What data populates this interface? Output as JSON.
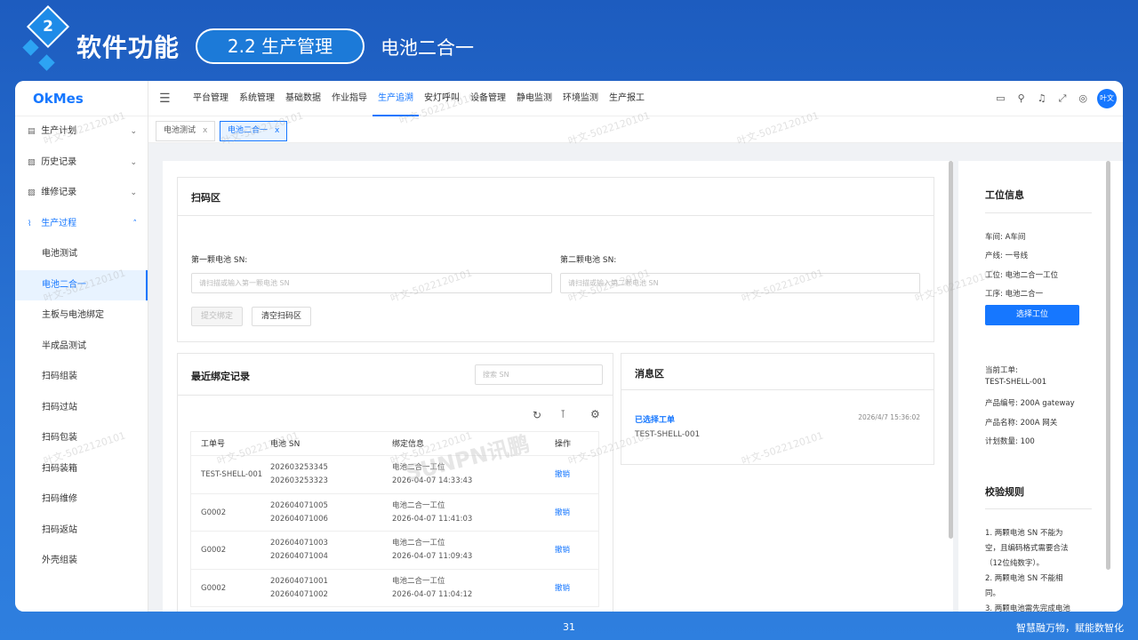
{
  "slide": {
    "number": "2",
    "title": "软件功能",
    "section": "2.2 生产管理",
    "subtitle": "电池二合一",
    "page": "31",
    "slogan": "智慧融万物，赋能数智化"
  },
  "app": {
    "logo": "OkMes",
    "watermark": "叶文-5022120101",
    "big_watermark": "SUNPN讯鹏",
    "user_avatar": "叶文"
  },
  "sidebar": {
    "groups": [
      {
        "label": "生产计划",
        "icon": "plan-icon",
        "expanded": false
      },
      {
        "label": "历史记录",
        "icon": "history-icon",
        "expanded": false
      },
      {
        "label": "维修记录",
        "icon": "repair-icon",
        "expanded": false
      },
      {
        "label": "生产过程",
        "icon": "process-icon",
        "expanded": true
      }
    ],
    "items": [
      "电池测试",
      "电池二合一",
      "主板与电池绑定",
      "半成品测试",
      "扫码组装",
      "扫码过站",
      "扫码包装",
      "扫码装箱",
      "扫码维修",
      "扫码返站",
      "外壳组装"
    ],
    "active_item": "电池二合一"
  },
  "topnav": {
    "items": [
      "平台管理",
      "系统管理",
      "基础数据",
      "作业指导",
      "生产追溯",
      "安灯呼叫",
      "设备管理",
      "静电监测",
      "环境监测",
      "生产报工"
    ],
    "active": "生产追溯",
    "icons": [
      "monitor-icon",
      "search-icon",
      "bell-icon",
      "fullscreen-icon",
      "globe-icon"
    ]
  },
  "tabs": [
    {
      "label": "电池测试",
      "active": false
    },
    {
      "label": "电池二合一",
      "active": true
    }
  ],
  "scan_area": {
    "title": "扫码区",
    "first_label": "第一颗电池 SN:",
    "first_placeholder": "请扫描或输入第一颗电池 SN",
    "second_label": "第二颗电池 SN:",
    "second_placeholder": "请扫描或输入第二颗电池 SN",
    "submit_label": "提交绑定",
    "clear_label": "清空扫码区"
  },
  "records": {
    "title": "最近绑定记录",
    "search_placeholder": "搜索 SN",
    "columns": [
      "工单号",
      "电池 SN",
      "绑定信息",
      "操作"
    ],
    "rows": [
      {
        "order": "TEST-SHELL-001",
        "sn1": "202603253345",
        "sn2": "202603253323",
        "station": "电池二合一工位",
        "time": "2026-04-07 14:33:43",
        "action": "撤销"
      },
      {
        "order": "G0002",
        "sn1": "202604071005",
        "sn2": "202604071006",
        "station": "电池二合一工位",
        "time": "2026-04-07 11:41:03",
        "action": "撤销"
      },
      {
        "order": "G0002",
        "sn1": "202604071003",
        "sn2": "202604071004",
        "station": "电池二合一工位",
        "time": "2026-04-07 11:09:43",
        "action": "撤销"
      },
      {
        "order": "G0002",
        "sn1": "202604071001",
        "sn2": "202604071002",
        "station": "电池二合一工位",
        "time": "2026-04-07 11:04:12",
        "action": "撤销"
      }
    ]
  },
  "messages": {
    "title": "消息区",
    "items": [
      {
        "heading": "已选择工单",
        "time": "2026/4/7 15:36:02",
        "body": "TEST-SHELL-001"
      }
    ]
  },
  "station_info": {
    "title": "工位信息",
    "workshop": "车间: A车间",
    "line": "产线: 一号线",
    "station": "工位: 电池二合一工位",
    "process": "工序: 电池二合一",
    "select_button": "选择工位",
    "order_label": "当前工单:",
    "order_value": "TEST-SHELL-001",
    "product_code": "产品编号: 200A gateway",
    "product_name": "产品名称: 200A 网关",
    "plan_qty": "计划数量: 100"
  },
  "rules": {
    "title": "校验规则",
    "lines": [
      "1. 两颗电池 SN 不能为",
      "空，且编码格式需要合法",
      "（12位纯数字）。",
      "2. 两颗电池 SN 不能相",
      "同。",
      "3. 两颗电池需先完成电池"
    ]
  },
  "colors": {
    "accent": "#1677ff",
    "slide_bg": "#1d5cbf",
    "deco": "#2da4f3"
  }
}
